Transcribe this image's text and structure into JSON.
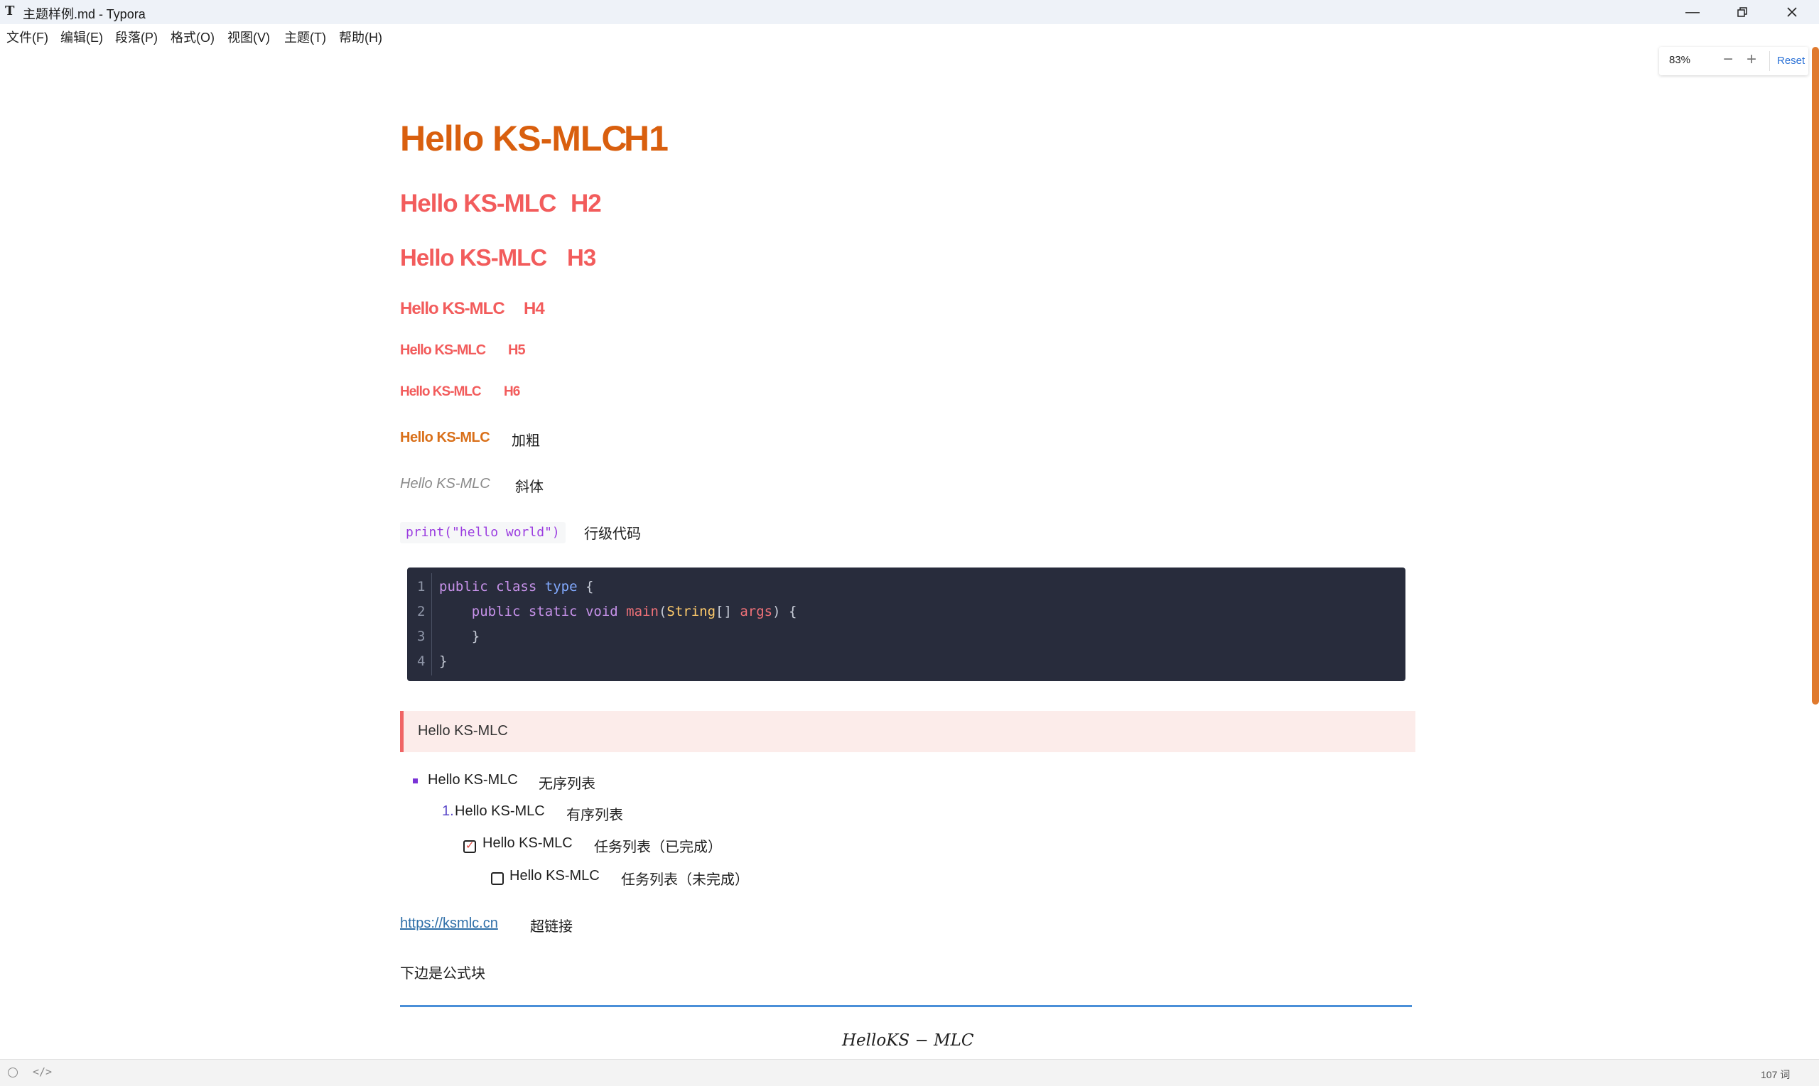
{
  "window": {
    "title": "主题样例.md - Typora",
    "app_icon": "T"
  },
  "menu": [
    "文件(F)",
    "编辑(E)",
    "段落(P)",
    "格式(O)",
    "视图(V)",
    "主题(T)",
    "帮助(H)"
  ],
  "zoom": {
    "value": "83%",
    "minus": "−",
    "plus": "+",
    "reset": "Reset"
  },
  "headings": [
    {
      "text": "Hello KS-MLC",
      "tag": "H1"
    },
    {
      "text": "Hello KS-MLC",
      "tag": "H2"
    },
    {
      "text": "Hello KS-MLC",
      "tag": "H3"
    },
    {
      "text": "Hello KS-MLC",
      "tag": "H4"
    },
    {
      "text": "Hello KS-MLC",
      "tag": "H5"
    },
    {
      "text": "Hello KS-MLC",
      "tag": "H6"
    }
  ],
  "bold": {
    "text": "Hello KS-MLC",
    "label": "加粗"
  },
  "italic": {
    "text": "Hello KS-MLC",
    "label": "斜体"
  },
  "inline_code": {
    "code": "print(\"hello world\")",
    "label": "行级代码"
  },
  "code_block": {
    "line_numbers": [
      "1",
      "2",
      "3",
      "4"
    ],
    "lines": [
      "public class type {",
      "    public static void main(String[] args) {",
      "    }",
      "}"
    ]
  },
  "blockquote": "Hello KS-MLC",
  "lists": {
    "unordered": {
      "text": "Hello KS-MLC",
      "label": "无序列表"
    },
    "ordered": {
      "number": "1.",
      "text": "Hello KS-MLC",
      "label": "有序列表"
    },
    "task_done": {
      "text": "Hello KS-MLC",
      "label": "任务列表（已完成）",
      "checked": true
    },
    "task_todo": {
      "text": "Hello KS-MLC",
      "label": "任务列表（未完成）",
      "checked": false
    }
  },
  "link": {
    "url": "https://ksmlc.cn",
    "label": "超链接"
  },
  "formula_intro": "下边是公式块",
  "formula": "HelloKS − MLC",
  "status": {
    "word_count": "107 词",
    "source_toggle": "</>"
  },
  "colors": {
    "accent": "#d95f0e",
    "heading": "#f25c5c",
    "code_bg": "#282c3c",
    "quote_bg": "#fcecea",
    "rule": "#4a8fd8"
  }
}
